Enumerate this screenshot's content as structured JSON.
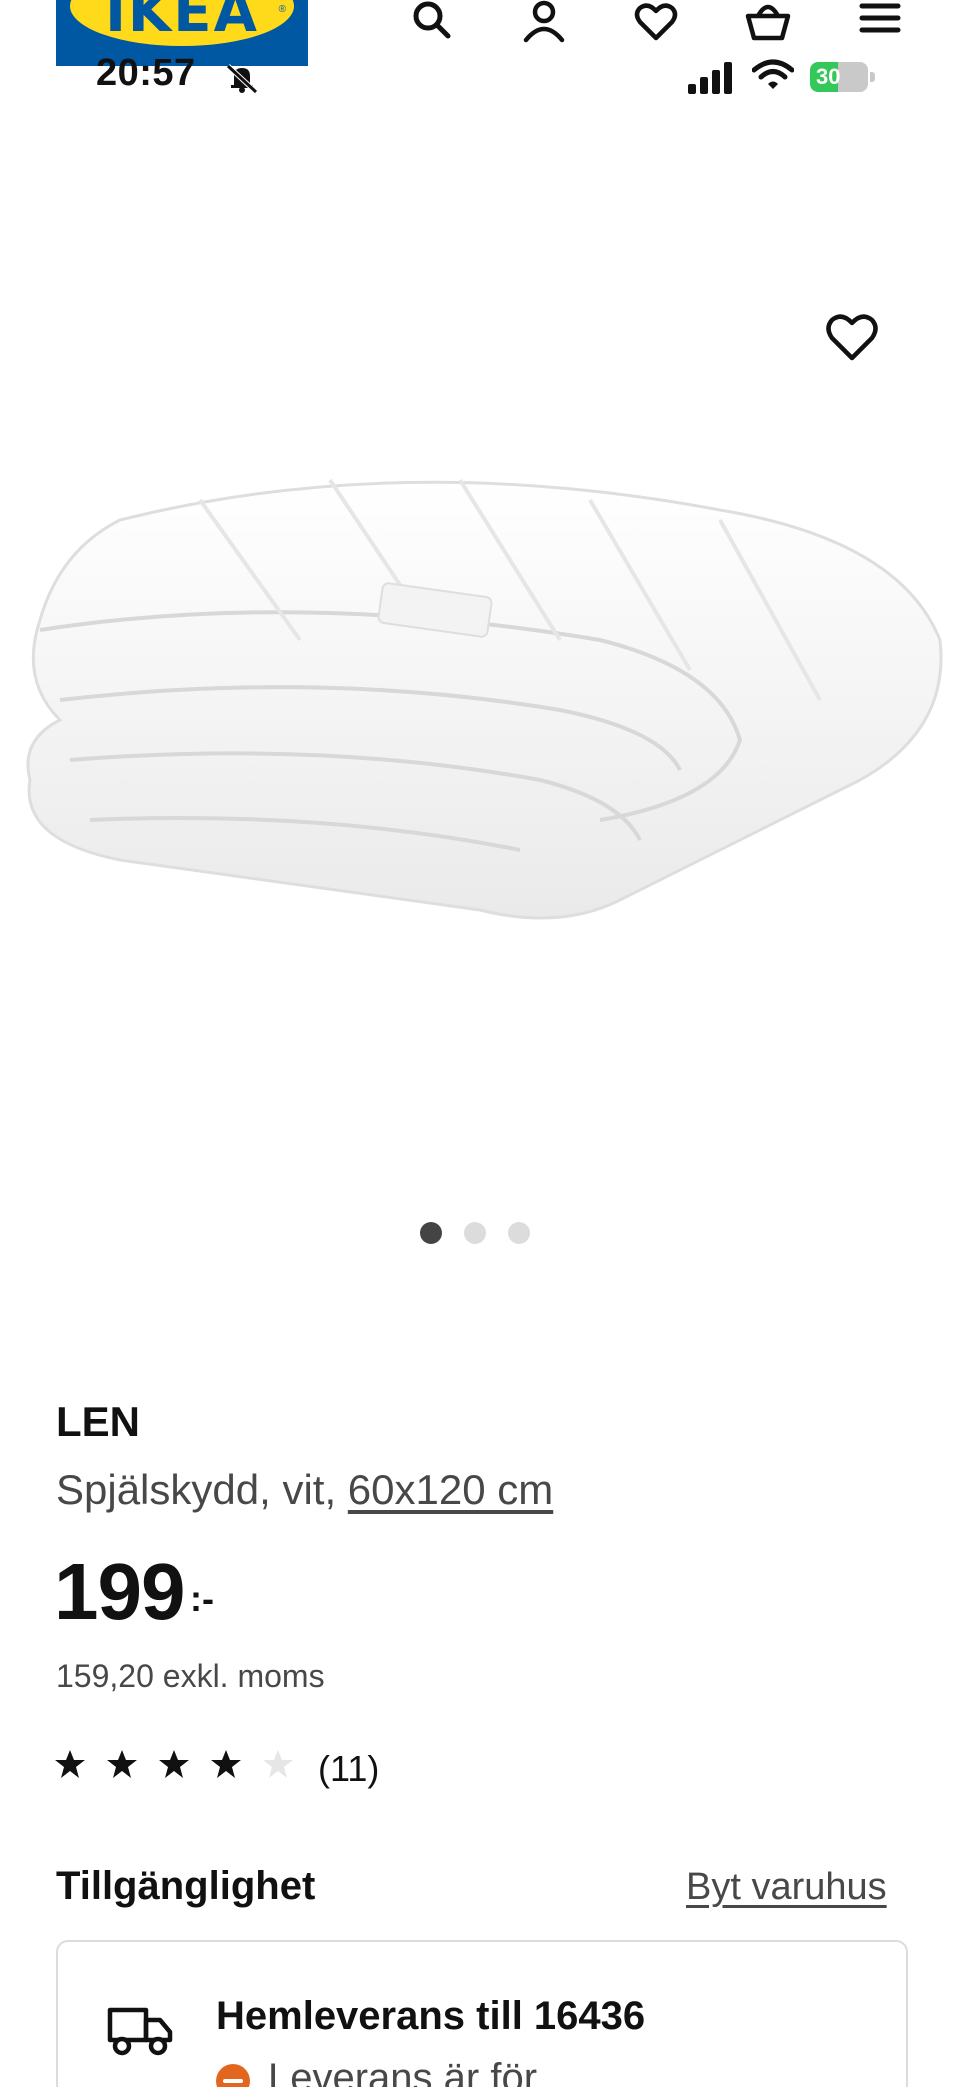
{
  "header": {
    "logo_text": "IKEA",
    "logo_reg": "®",
    "icons": [
      "search-icon",
      "user-icon",
      "heart-icon",
      "basket-icon",
      "menu-icon"
    ]
  },
  "status_bar": {
    "time": "20:57",
    "battery": "30"
  },
  "gallery": {
    "image_count": 3,
    "active_index": 0
  },
  "product": {
    "name": "LEN",
    "description_prefix": "Spjälskydd, vit, ",
    "size": "60x120 cm",
    "price": "199",
    "price_suffix": ":-",
    "price_excl_vat": "159,20 exkl. moms",
    "rating": 4,
    "rating_max": 5,
    "review_count": "(11)"
  },
  "availability": {
    "title": "Tillgänglighet",
    "change_store": "Byt varuhus",
    "delivery_title": "Hemleverans till 16436",
    "delivery_status": "Leverans är för"
  },
  "colors": {
    "ikea_blue": "#0058a3",
    "ikea_yellow": "#ffda1a",
    "status_orange": "#e2661d"
  }
}
